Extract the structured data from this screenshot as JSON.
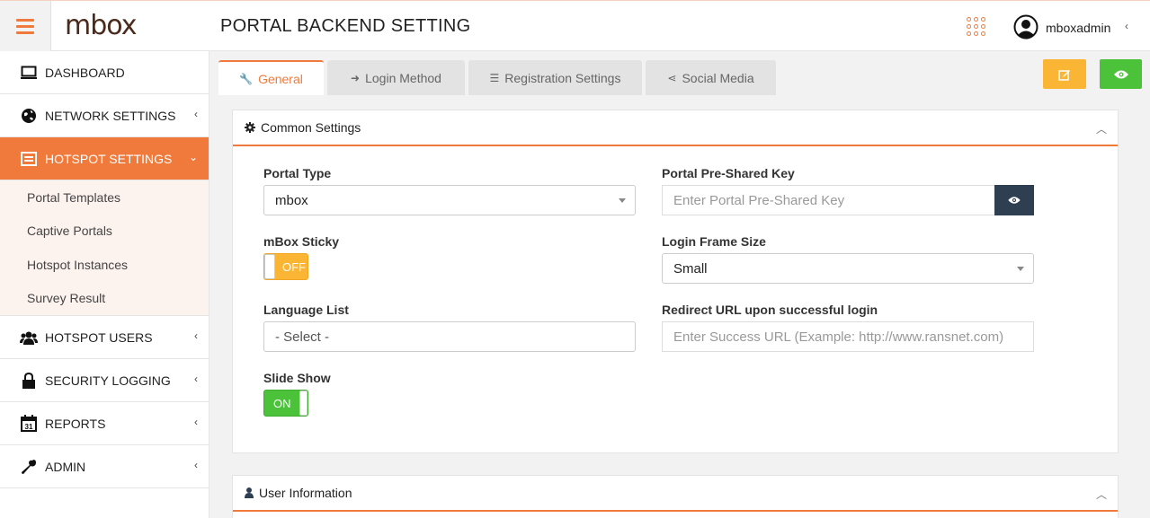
{
  "header": {
    "logo_text": "mbox",
    "page_title": "PORTAL BACKEND SETTING",
    "username": "mboxadmin"
  },
  "sidebar": {
    "items": [
      {
        "label": "DASHBOARD",
        "icon": "monitor-icon"
      },
      {
        "label": "NETWORK SETTINGS",
        "icon": "globe-icon"
      },
      {
        "label": "HOTSPOT SETTINGS",
        "icon": "window-icon",
        "active": true
      },
      {
        "label": "HOTSPOT USERS",
        "icon": "users-icon"
      },
      {
        "label": "SECURITY LOGGING",
        "icon": "lock-icon"
      },
      {
        "label": "REPORTS",
        "icon": "calendar-icon"
      },
      {
        "label": "ADMIN",
        "icon": "wrench-icon"
      }
    ],
    "subitems": [
      "Portal Templates",
      "Captive Portals",
      "Hotspot Instances",
      "Survey Result"
    ],
    "calendar_day": "31"
  },
  "tabs": [
    {
      "label": "General",
      "active": true
    },
    {
      "label": "Login Method"
    },
    {
      "label": "Registration Settings"
    },
    {
      "label": "Social Media"
    }
  ],
  "common_settings": {
    "title": "Common Settings",
    "portal_type": {
      "label": "Portal Type",
      "value": "mbox"
    },
    "psk": {
      "label": "Portal Pre-Shared Key",
      "placeholder": "Enter Portal Pre-Shared Key"
    },
    "sticky": {
      "label": "mBox Sticky",
      "state": "OFF"
    },
    "frame_size": {
      "label": "Login Frame Size",
      "value": "Small"
    },
    "language": {
      "label": "Language List",
      "value": "- Select -"
    },
    "redirect": {
      "label": "Redirect URL upon successful login",
      "placeholder": "Enter Success URL (Example: http://www.ransnet.com)"
    },
    "slideshow": {
      "label": "Slide Show",
      "state": "ON"
    }
  },
  "user_info": {
    "title": "User Information"
  },
  "colors": {
    "accent": "#f07a3c",
    "warning": "#fbb535",
    "success": "#4cc23b",
    "dark": "#2e3f52"
  }
}
